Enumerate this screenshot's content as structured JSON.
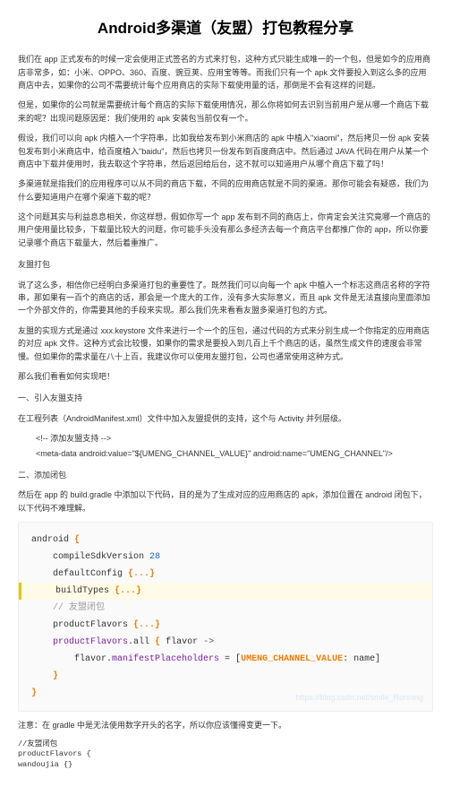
{
  "title": "Android多渠道（友盟）打包教程分享",
  "p1": "我们在 app 正式发布的时候一定会使用正式签名的方式来打包，这种方式只能生成唯一的一个包，但是如今的应用商店非常多，如：小米、OPPO、360、百度、豌豆荚、应用宝等等。而我们只有一个 apk 文件要投入到这么多的应用商店中去，如果你的公司不需要统计每个应用商店的实际下载使用量的话，那倒是不会有这样的问题。",
  "p2": "但是，如果你的公司就是需要统计每个商店的实际下载使用情况，那么你将如何去识别当前用户是从哪一个商店下载来的呢？出现问题原因是：我们使用的 apk 安装包当前仅有一个。",
  "p3": "假设，我们可以向 apk 内植入一个字符串，比如我给发布到小米商店的 apk 中植入\"xiaomi\"，然后拷贝一份 apk 安装包发布到小米商店中，给百度植入\"baidu\"，然后也拷贝一份发布到百度商店中。然后通过 JAVA 代码在用户从某一个商店中下载并使用时，我去取这个字符串，然后返回给后台，这不就可以知道用户从哪个商店下载了吗！",
  "p4": "多渠道就是指我们的应用程序可以从不同的商店下载，不同的应用商店就是不同的渠道。那你可能会有疑惑，我们为什么要知道用户在哪个渠道下载的呢？",
  "p5": "这个问题其实与利益息息相关，你这样想，假如你写一个 app 发布到不同的商店上，你肯定会关注究竟哪一个商店的用户使用量比较多，下载量比较大的问题，你可能手头没有那么多经济去每一个商店平台都推广你的 app，所以你要记录哪个商店下载量大，然后着重推广。",
  "h_friend": "友盟打包",
  "p6": "说了这么多，相信你已经明白多渠道打包的重要性了。既然我们可以向每一个 apk 中植入一个标志这商店名称的字符串，那如果有一百个的商店的话，那会是一个庞大的工作，没有多大实际意义，而且 apk 文件是无法直接向里面添加一个外部文件的，你需要其他的手段来实现。那么我们先来看看友盟多渠道打包的方式。",
  "p7": "友盟的实现方式是通过 xxx.keystore 文件来进行一个一个的压包，通过代码的方式来分别生成一个你指定的应用商店的对应 apk 文件。这种方式会比较慢，如果你的需求是要投入到几百上千个商店的话，虽然生成文件的速度会非常慢。但如果你的需求量在八十上百，我建议你可以使用友盟打包，公司也通常使用这种方式。",
  "p8": "那么我们看看如何实现吧！",
  "s1": "一、引入友盟支持",
  "p9": "在工程列表（AndroidManifest.xml）文件中加入友盟提供的支持，这个与 Activity 并列层级。",
  "xml1": "<!-- 添加友盟支持 -->",
  "xml2": "<meta-data android:value=\"${UMENG_CHANNEL_VALUE}\" android:name=\"UMENG_CHANNEL\"/>",
  "s2": "二、添加闭包",
  "p10": "然后在 app 的 build.gradle 中添加以下代码，目的是为了生成对应的应用商店的 apk，添加位置在 android 闭包下，以下代码不难理解。",
  "code": {
    "l1a": "android ",
    "l1b": "{",
    "l2a": "    compileSdkVersion ",
    "l2b": "28",
    "l3a": "    defaultConfig ",
    "l3b": "{...}",
    "l4a": "    buildTypes ",
    "l4b": "{...}",
    "l5": "",
    "l6": "    // 友盟闭包",
    "l7a": "    productFlavors ",
    "l7b": "{...}",
    "l8a": "    productFlavors",
    "l8b": ".all ",
    "l8c": "{",
    "l8d": " flavor ",
    "l8e": "->",
    "l9a": "        flavor.",
    "l9b": "manifestPlaceholders",
    "l9c": " = [",
    "l9d": "UMENG_CHANNEL_VALUE",
    "l9e": ": name]",
    "l10": "    }",
    "l11": "}"
  },
  "watermark": "https://blog.csdn.net/smile_Running",
  "note": "注意：在 gradle 中是无法使用数字开头的名字，所以你应该懂得变更一下。",
  "footer1": "//友盟闭包",
  "footer2": "productFlavors {",
  "footer3": "  wandoujia {}"
}
